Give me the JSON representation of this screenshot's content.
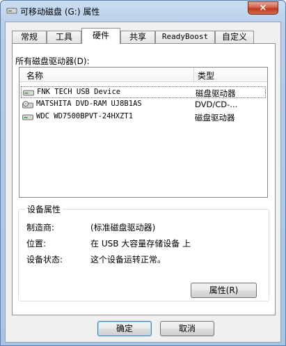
{
  "window": {
    "title": "可移动磁盘 (G:) 属性",
    "close_label": "×"
  },
  "tabs": [
    {
      "label": "常规"
    },
    {
      "label": "工具"
    },
    {
      "label": "硬件"
    },
    {
      "label": "共享"
    },
    {
      "label": "ReadyBoost"
    },
    {
      "label": "自定义"
    }
  ],
  "hardware": {
    "list_label": "所有磁盘驱动器(D):",
    "columns": {
      "name": "名称",
      "type": "类型"
    },
    "devices": [
      {
        "name": "FNK TECH USB Device",
        "type": "磁盘驱动器",
        "icon": "disk-drive-icon"
      },
      {
        "name": "MATSHITA DVD-RAM UJ8B1AS",
        "type": "DVD/CD-...",
        "icon": "dvd-drive-icon"
      },
      {
        "name": "WDC WD7500BPVT-24HXZT1",
        "type": "磁盘驱动器",
        "icon": "disk-drive-icon"
      }
    ],
    "group_title": "设备属性",
    "properties": [
      {
        "label": "制造商:",
        "value": "(标准磁盘驱动器)"
      },
      {
        "label": "位置:",
        "value": "在 USB 大容量存储设备 上"
      },
      {
        "label": "设备状态:",
        "value": "这个设备运转正常。"
      }
    ],
    "properties_button": "属性(R)"
  },
  "footer": {
    "ok": "确定",
    "cancel": "取消"
  },
  "colors": {
    "title_bar": "#b7cde8",
    "close_button": "#c0391c",
    "selection_border": "#666666"
  }
}
